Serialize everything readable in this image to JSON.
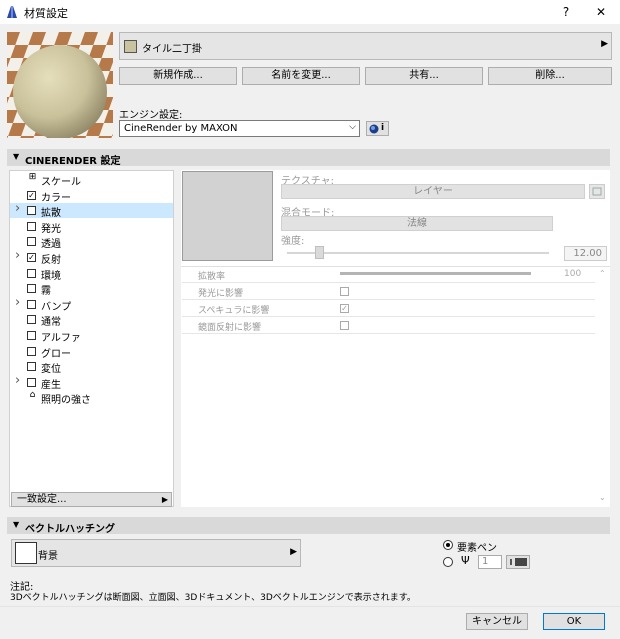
{
  "window": {
    "title": "材質設定",
    "help_label": "?",
    "close_label": "✕"
  },
  "material": {
    "name": "タイル二丁掛",
    "swatch_color": "#c9c3a0"
  },
  "buttons": {
    "new": "新規作成...",
    "rename": "名前を変更...",
    "share": "共有...",
    "delete": "削除..."
  },
  "engine": {
    "label": "エンジン設定:",
    "selected": "CineRender by MAXON",
    "info_label": "i"
  },
  "cinerender": {
    "section_title": "CINERENDER 設定",
    "channels": [
      {
        "label": "スケール",
        "checked": false,
        "expandable": false,
        "selected": false,
        "icon": "scale-icon"
      },
      {
        "label": "カラー",
        "checked": true,
        "expandable": false,
        "selected": false
      },
      {
        "label": "拡散",
        "checked": false,
        "expandable": true,
        "selected": true
      },
      {
        "label": "発光",
        "checked": false,
        "expandable": false,
        "selected": false
      },
      {
        "label": "透過",
        "checked": false,
        "expandable": false,
        "selected": false
      },
      {
        "label": "反射",
        "checked": true,
        "expandable": true,
        "selected": false
      },
      {
        "label": "環境",
        "checked": false,
        "expandable": false,
        "selected": false
      },
      {
        "label": "霧",
        "checked": false,
        "expandable": false,
        "selected": false
      },
      {
        "label": "バンプ",
        "checked": false,
        "expandable": true,
        "selected": false
      },
      {
        "label": "通常",
        "checked": false,
        "expandable": false,
        "selected": false
      },
      {
        "label": "アルファ",
        "checked": false,
        "expandable": false,
        "selected": false
      },
      {
        "label": "グロー",
        "checked": false,
        "expandable": false,
        "selected": false
      },
      {
        "label": "変位",
        "checked": false,
        "expandable": false,
        "selected": false
      },
      {
        "label": "産生",
        "checked": false,
        "expandable": true,
        "selected": false
      },
      {
        "label": "照明の強さ",
        "checked": false,
        "expandable": false,
        "selected": false,
        "icon": "lighting-icon"
      }
    ],
    "match_settings": "一致設定...",
    "texture_label": "テクスチャ:",
    "layer_button": "レイヤー",
    "blend_mode_label": "混合モード:",
    "blend_mode_value": "法線",
    "strength_label": "強度:",
    "strength_value": "12.00",
    "properties": {
      "diffusion_rate": {
        "label": "拡散率",
        "value": "100"
      },
      "affect_emission": {
        "label": "発光に影響",
        "checked": false
      },
      "affect_specular": {
        "label": "スペキュラに影響",
        "checked": true
      },
      "affect_reflection": {
        "label": "鏡面反射に影響",
        "checked": false
      }
    }
  },
  "vector_hatch": {
    "section_title": "ベクトルハッチング",
    "pattern": "背景",
    "element_pen_label": "要素ペン",
    "pen_value": "1"
  },
  "note": {
    "title": "注記:",
    "text": "3Dベクトルハッチングは断面図、立面図、3Dドキュメント、3Dベクトルエンジンで表示されます。"
  },
  "footer": {
    "cancel": "キャンセル",
    "ok": "OK"
  }
}
